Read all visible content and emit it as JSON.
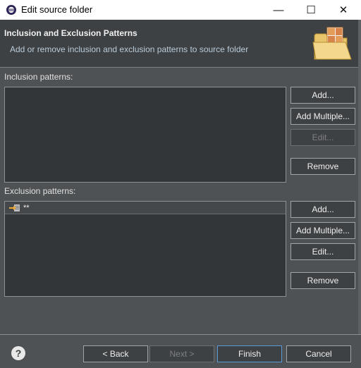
{
  "window": {
    "title": "Edit source folder",
    "minimize_glyph": "—",
    "maximize_glyph": "☐",
    "close_glyph": "✕"
  },
  "header": {
    "title": "Inclusion and Exclusion Patterns",
    "description": "Add or remove inclusion and exclusion patterns to source folder",
    "icon": "folder-icon"
  },
  "inclusion": {
    "label": "Inclusion patterns:",
    "items": [],
    "buttons": {
      "add": "Add...",
      "add_multiple": "Add Multiple...",
      "edit": "Edit...",
      "remove": "Remove"
    }
  },
  "exclusion": {
    "label": "Exclusion patterns:",
    "items": [
      {
        "pattern": "**",
        "icon": "exclusion-pattern-icon",
        "selected": true
      }
    ],
    "buttons": {
      "add": "Add...",
      "add_multiple": "Add Multiple...",
      "edit": "Edit...",
      "remove": "Remove"
    }
  },
  "footer": {
    "help_glyph": "?",
    "back": "< Back",
    "next": "Next >",
    "finish": "Finish",
    "cancel": "Cancel"
  }
}
